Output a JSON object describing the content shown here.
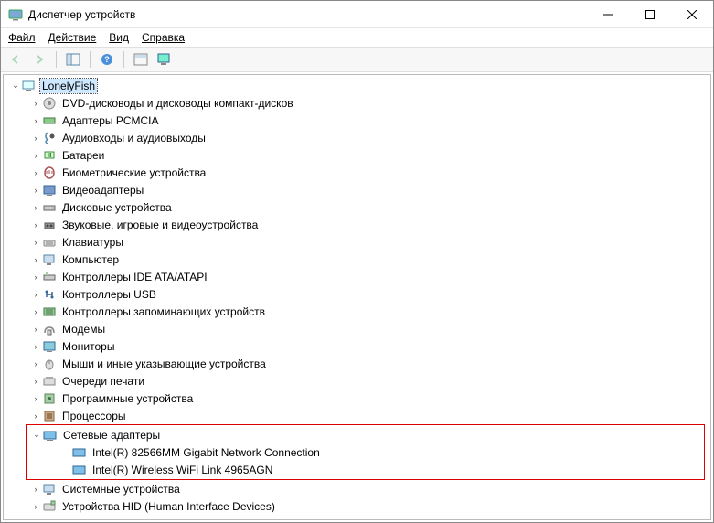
{
  "window": {
    "title": "Диспетчер устройств"
  },
  "menu": {
    "file": "Файл",
    "action": "Действие",
    "view": "Вид",
    "help": "Справка"
  },
  "tree": {
    "root": "LonelyFish",
    "items": [
      "DVD-дисководы и дисководы компакт-дисков",
      "Адаптеры PCMCIA",
      "Аудиовходы и аудиовыходы",
      "Батареи",
      "Биометрические устройства",
      "Видеоадаптеры",
      "Дисковые устройства",
      "Звуковые, игровые и видеоустройства",
      "Клавиатуры",
      "Компьютер",
      "Контроллеры IDE ATA/ATAPI",
      "Контроллеры USB",
      "Контроллеры запоминающих устройств",
      "Модемы",
      "Мониторы",
      "Мыши и иные указывающие устройства",
      "Очереди печати",
      "Программные устройства",
      "Процессоры"
    ],
    "network": {
      "label": "Сетевые адаптеры",
      "children": [
        "Intel(R) 82566MM Gigabit Network Connection",
        "Intel(R) Wireless WiFi Link 4965AGN"
      ]
    },
    "after": [
      "Системные устройства",
      "Устройства HID (Human Interface Devices)"
    ]
  }
}
